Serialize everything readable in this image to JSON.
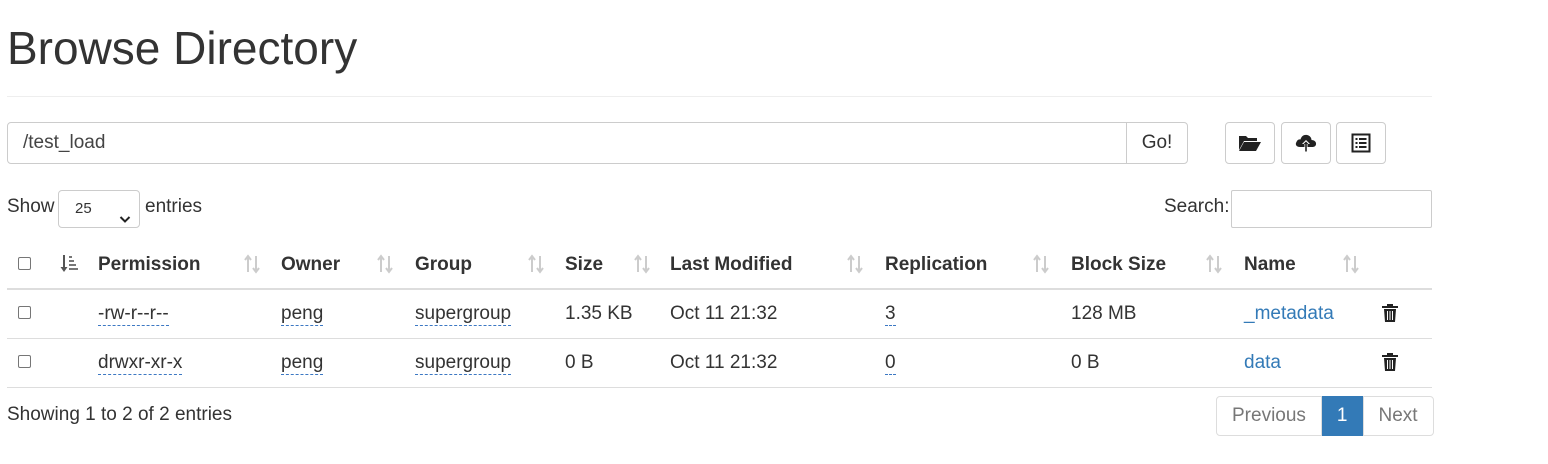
{
  "page": {
    "title": "Browse Directory"
  },
  "path_bar": {
    "path": "/test_load",
    "go_label": "Go!"
  },
  "toolbar": {
    "buttons": [
      {
        "icon": "folder-open-icon"
      },
      {
        "icon": "cloud-upload-icon"
      },
      {
        "icon": "list-alt-icon"
      }
    ]
  },
  "length_menu": {
    "show_label": "Show",
    "selected": "25",
    "entries_label": "entries"
  },
  "search": {
    "label": "Search:",
    "value": ""
  },
  "table": {
    "headers": [
      "Permission",
      "Owner",
      "Group",
      "Size",
      "Last Modified",
      "Replication",
      "Block Size",
      "Name"
    ],
    "rows": [
      {
        "permission": "-rw-r--r--",
        "owner": "peng",
        "group": "supergroup",
        "size": "1.35 KB",
        "modified": "Oct 11 21:32",
        "replication": "3",
        "block_size": "128 MB",
        "name": "_metadata"
      },
      {
        "permission": "drwxr-xr-x",
        "owner": "peng",
        "group": "supergroup",
        "size": "0 B",
        "modified": "Oct 11 21:32",
        "replication": "0",
        "block_size": "0 B",
        "name": "data"
      }
    ]
  },
  "footer": {
    "info": "Showing 1 to 2 of 2 entries"
  },
  "pagination": {
    "previous": "Previous",
    "current": "1",
    "next": "Next"
  },
  "colors": {
    "link": "#337ab7",
    "active_page": "#337ab7",
    "border": "#dddddd"
  }
}
